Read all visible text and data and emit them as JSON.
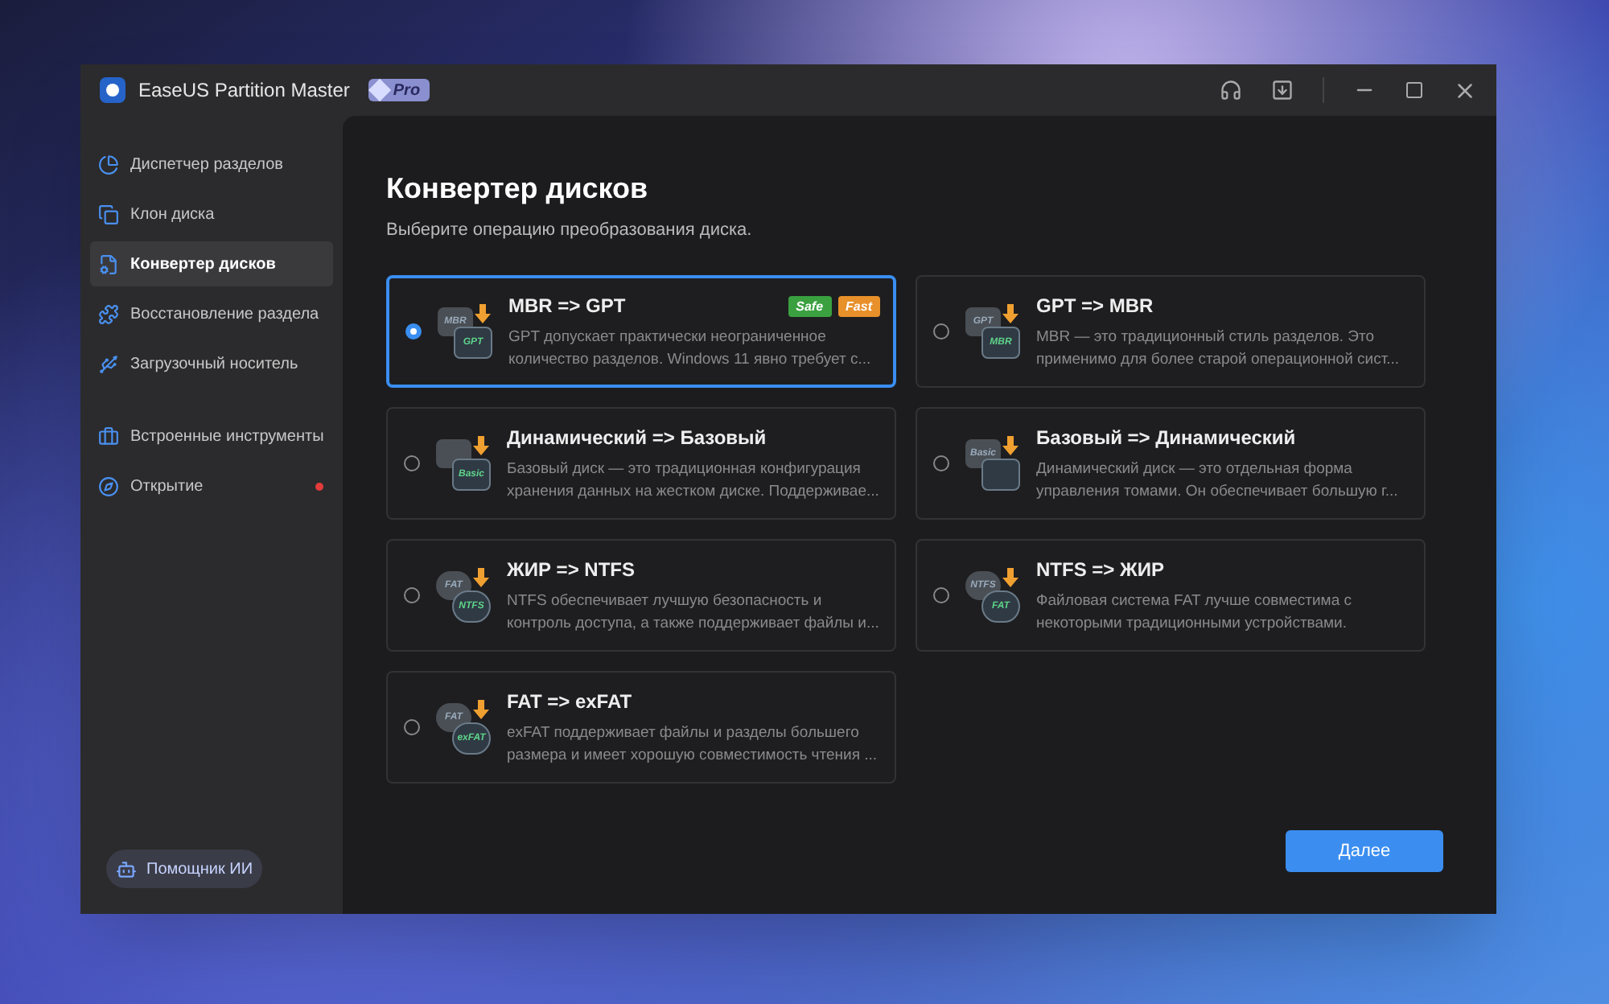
{
  "window": {
    "title": "EaseUS Partition Master",
    "edition": "Pro"
  },
  "sidebar": {
    "sections": [
      [
        {
          "label": "Диспетчер разделов",
          "selected": false,
          "notification": false
        },
        {
          "label": "Клон диска",
          "selected": false,
          "notification": false
        },
        {
          "label": "Конвертер дисков",
          "selected": true,
          "notification": false
        },
        {
          "label": "Восстановление раздела",
          "selected": false,
          "notification": false
        },
        {
          "label": "Загрузочный носитель",
          "selected": false,
          "notification": false
        }
      ],
      [
        {
          "label": "Встроенные инструменты",
          "selected": false,
          "notification": false
        },
        {
          "label": "Открытие",
          "selected": false,
          "notification": true
        }
      ]
    ],
    "assistant": "Помощник ИИ"
  },
  "page": {
    "title": "Конвертер дисков",
    "subtitle": "Выберите операцию преобразования диска."
  },
  "options": [
    {
      "title": "MBR => GPT",
      "description": "GPT допускает практически неограниченное количество разделов. Windows 11 явно требует с...",
      "selected": true,
      "kind": "disk",
      "icon_top": "MBR",
      "icon_bottom": "GPT",
      "badges": [
        {
          "label": "Safe",
          "color": "#3aa040"
        },
        {
          "label": "Fast",
          "color": "#e8902a"
        }
      ]
    },
    {
      "title": "GPT => MBR",
      "description": "MBR — это традиционный стиль разделов. Это применимо для более старой операционной сист...",
      "selected": false,
      "kind": "disk",
      "icon_top": "GPT",
      "icon_bottom": "MBR"
    },
    {
      "title": "Динамический => Базовый",
      "description": "Базовый диск — это традиционная конфигурация хранения данных на жестком диске. Поддерживае...",
      "selected": false,
      "kind": "disk",
      "icon_bottom": "Basic"
    },
    {
      "title": "Базовый => Динамический",
      "description": "Динамический диск — это отдельная форма управления томами. Он обеспечивает большую г...",
      "selected": false,
      "kind": "disk",
      "icon_top": "Basic"
    },
    {
      "title": "ЖИР => NTFS",
      "description": "NTFS обеспечивает лучшую безопасность и контроль доступа, а также поддерживает файлы и...",
      "selected": false,
      "kind": "round",
      "icon_top": "FAT",
      "icon_bottom": "NTFS"
    },
    {
      "title": "NTFS => ЖИР",
      "description": "Файловая система FAT лучше совместима с некоторыми традиционными устройствами.",
      "selected": false,
      "kind": "round",
      "icon_top": "NTFS",
      "icon_bottom": "FAT"
    },
    {
      "title": "FAT => exFAT",
      "description": "exFAT поддерживает файлы и разделы большего размера и имеет хорошую совместимость чтения ...",
      "selected": false,
      "kind": "round",
      "icon_top": "FAT",
      "icon_bottom": "exFAT"
    }
  ],
  "next_button": "Далее"
}
